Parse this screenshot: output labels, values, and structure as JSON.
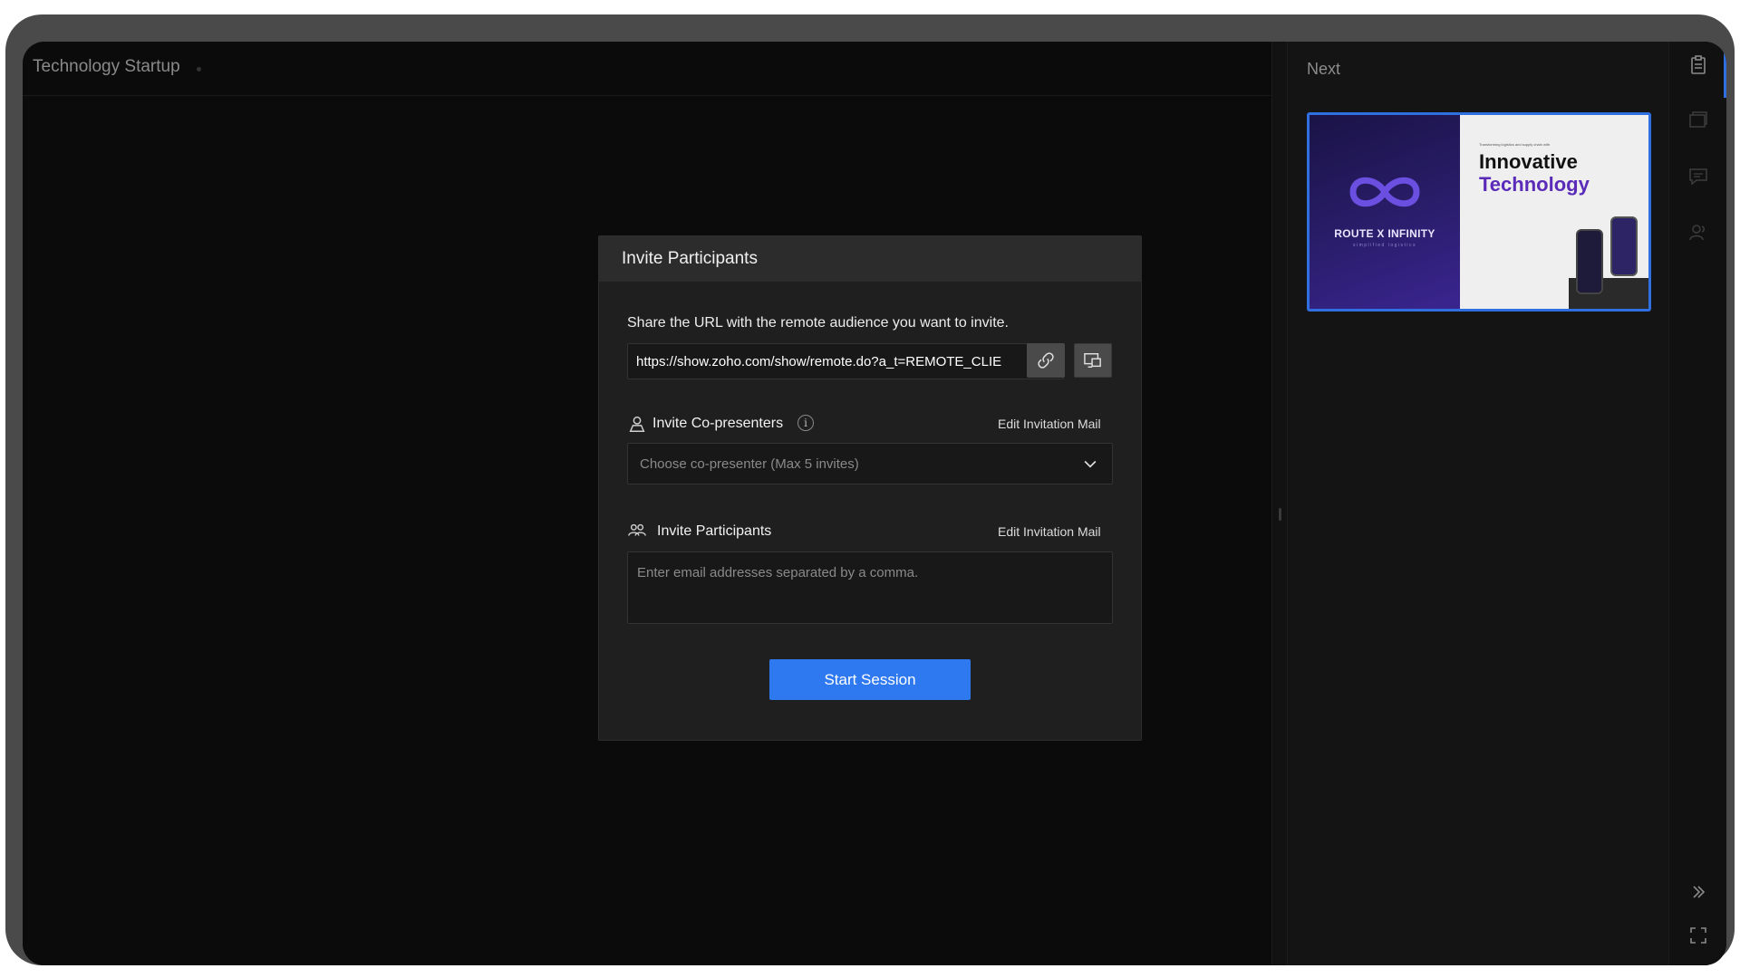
{
  "app": {
    "doc_title": "Technology Startup"
  },
  "next_panel": {
    "label": "Next",
    "thumbnail": {
      "brand_name": "ROUTE X INFINITY",
      "brand_sub": "simplified logistics",
      "small_caption": "Transforming logistics and supply chain with",
      "heading_line1": "Innovative",
      "heading_line2": "Technology"
    }
  },
  "rail_icons": [
    "slide-notes-icon",
    "slide-grid-icon",
    "chat-icon",
    "participants-icon",
    "collapse-panel-icon",
    "fullscreen-icon"
  ],
  "modal": {
    "title": "Invite Participants",
    "share_text": "Share the URL with the remote audience you want to invite.",
    "url": "https://show.zoho.com/show/remote.do?a_t=REMOTE_CLIE",
    "co_presenters": {
      "label": "Invite Co-presenters",
      "info": "i",
      "edit_link": "Edit Invitation Mail",
      "select_placeholder": "Choose co-presenter (Max 5 invites)"
    },
    "participants": {
      "label": "Invite Participants",
      "edit_link": "Edit Invitation Mail",
      "email_placeholder": "Enter email addresses separated by a comma."
    },
    "start_button": "Start Session"
  },
  "colors": {
    "accent": "#2f79f0",
    "thumb_border": "#2f6fe0",
    "brand_purple": "#5a2bb8"
  }
}
